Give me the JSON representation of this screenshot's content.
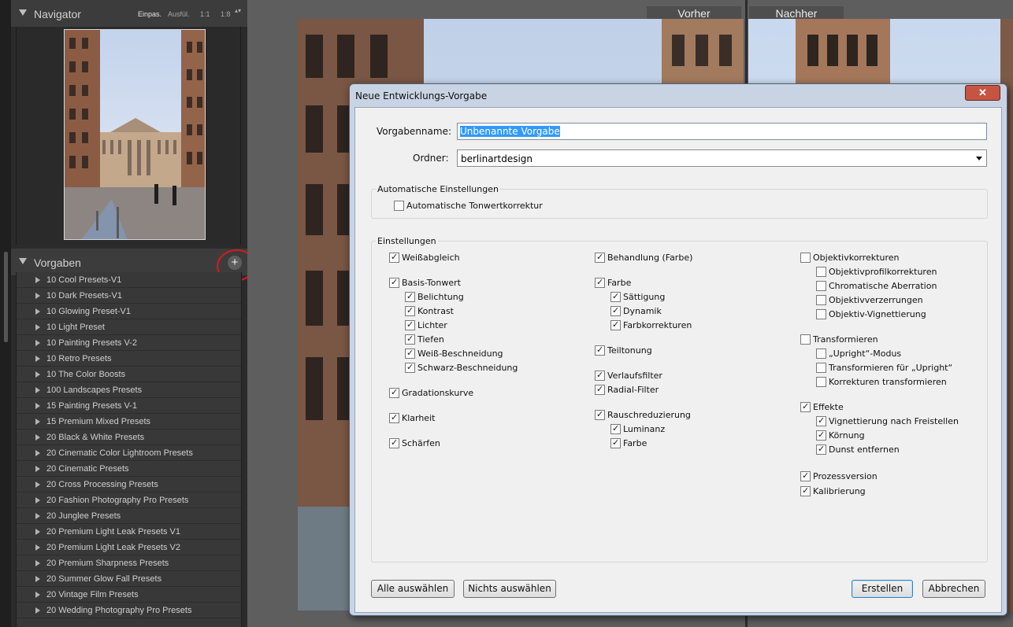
{
  "navigator": {
    "title": "Navigator",
    "zoom_options": [
      "Einpas.",
      "Ausfül.",
      "1:1",
      "1:8"
    ],
    "zoom_arrows": "▴▾"
  },
  "presets_panel": {
    "title": "Vorgaben",
    "add_button": "+",
    "items": [
      "10 Cool Presets-V1",
      "10 Dark Presets-V1",
      "10 Glowing Preset-V1",
      "10 Light Preset",
      "10 Painting Presets V-2",
      "10 Retro Presets",
      "10 The Color Boosts",
      "100 Landscapes Presets",
      "15 Painting Presets V-1",
      "15 Premium Mixed Presets",
      "20 Black & White Presets",
      "20 Cinematic Color Lightroom Presets",
      "20 Cinematic Presets",
      "20 Cross Processing Presets",
      "20 Fashion Photography Pro Presets",
      "20 Junglee Presets",
      "20 Premium Light Leak Presets V1",
      "20 Premium Light Leak Presets V2",
      "20 Premium Sharpness Presets",
      "20 Summer Glow Fall Presets",
      "20 Vintage Film Presets",
      "20 Wedding Photography Pro Presets"
    ]
  },
  "view": {
    "before_label": "Vorher",
    "after_label": "Nachher"
  },
  "dialog": {
    "title": "Neue Entwicklungs-Vorgabe",
    "close_label": "✕",
    "name_label": "Vorgabenname:",
    "name_value": "Unbenannte Vorgabe",
    "folder_label": "Ordner:",
    "folder_value": "berlinartdesign",
    "auto_group": {
      "title": "Automatische Einstellungen",
      "auto_tone": {
        "label": "Automatische Tonwertkorrektur",
        "checked": false
      }
    },
    "settings_group_title": "Einstellungen",
    "col1": [
      {
        "label": "Weißabgleich",
        "checked": true
      },
      {
        "label": "Basis-Tonwert",
        "checked": true
      },
      {
        "label": "Belichtung",
        "checked": true
      },
      {
        "label": "Kontrast",
        "checked": true
      },
      {
        "label": "Lichter",
        "checked": true
      },
      {
        "label": "Tiefen",
        "checked": true
      },
      {
        "label": "Weiß-Beschneidung",
        "checked": true
      },
      {
        "label": "Schwarz-Beschneidung",
        "checked": true
      },
      {
        "label": "Gradationskurve",
        "checked": true
      },
      {
        "label": "Klarheit",
        "checked": true
      },
      {
        "label": "Schärfen",
        "checked": true
      }
    ],
    "col2": [
      {
        "label": "Behandlung (Farbe)",
        "checked": true
      },
      {
        "label": "Farbe",
        "checked": true
      },
      {
        "label": "Sättigung",
        "checked": true
      },
      {
        "label": "Dynamik",
        "checked": true
      },
      {
        "label": "Farbkorrekturen",
        "checked": true
      },
      {
        "label": "Teiltonung",
        "checked": true
      },
      {
        "label": "Verlaufsfilter",
        "checked": true
      },
      {
        "label": "Radial-Filter",
        "checked": true
      },
      {
        "label": "Rauschreduzierung",
        "checked": true
      },
      {
        "label": "Luminanz",
        "checked": true
      },
      {
        "label": "Farbe",
        "checked": true
      }
    ],
    "col3": [
      {
        "label": "Objektivkorrekturen",
        "checked": false
      },
      {
        "label": "Objektivprofilkorrekturen",
        "checked": false
      },
      {
        "label": "Chromatische Aberration",
        "checked": false
      },
      {
        "label": "Objektivverzerrungen",
        "checked": false
      },
      {
        "label": "Objektiv-Vignettierung",
        "checked": false
      },
      {
        "label": "Transformieren",
        "checked": false
      },
      {
        "label": "„Upright“-Modus",
        "checked": false
      },
      {
        "label": "Transformieren für „Upright“",
        "checked": false
      },
      {
        "label": "Korrekturen transformieren",
        "checked": false
      },
      {
        "label": "Effekte",
        "checked": true
      },
      {
        "label": "Vignettierung nach Freistellen",
        "checked": true
      },
      {
        "label": "Körnung",
        "checked": true
      },
      {
        "label": "Dunst entfernen",
        "checked": true
      },
      {
        "label": "Prozessversion",
        "checked": true
      },
      {
        "label": "Kalibrierung",
        "checked": true
      }
    ],
    "buttons": {
      "select_all": "Alle auswählen",
      "select_none": "Nichts auswählen",
      "create": "Erstellen",
      "cancel": "Abbrechen"
    }
  }
}
